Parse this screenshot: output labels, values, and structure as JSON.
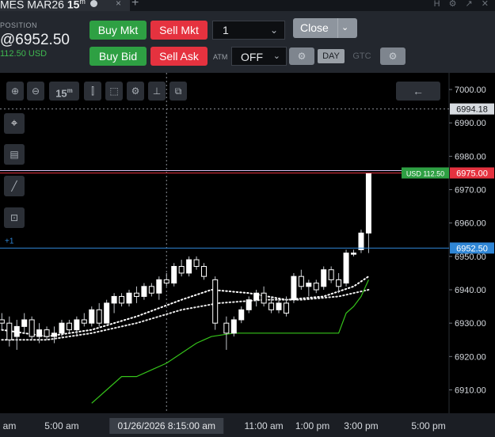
{
  "tab": {
    "title_a": "MES MAR26 ",
    "title_b": "15",
    "title_sup": "m",
    "close": "×",
    "plus": "+",
    "icons": "H ⚙ ↗ ✕"
  },
  "position": {
    "label": "POSITION",
    "price": "@6952.50",
    "usd": "112.50 USD"
  },
  "buttons": {
    "buy_mkt": "Buy Mkt",
    "sell_mkt": "Sell Mkt",
    "buy_bid": "Buy Bid",
    "sell_ask": "Sell Ask",
    "close": "Close",
    "quantity": "1",
    "atm_label": "ATM",
    "atm_value": "OFF",
    "day": "DAY",
    "gtc": "GTC"
  },
  "toolbar": {
    "interval": "15",
    "interval_sup": "m"
  },
  "colors": {
    "green": "#2ea043",
    "red": "#e5323f",
    "blue": "#2f86d6",
    "chart_bg": "#000000"
  },
  "chart_data": {
    "type": "candlestick",
    "title": "",
    "ylim": [
      6903,
      7005
    ],
    "y_ticks": [
      7000,
      6990,
      6980,
      6970,
      6960,
      6950,
      6940,
      6930,
      6920,
      6910
    ],
    "y_tick_labels": [
      "7000.00",
      "6990.00",
      "6980.00",
      "6970.00",
      "6960.00",
      "6950.00",
      "6940.00",
      "6930.00",
      "6920.00",
      "6910.00"
    ],
    "x_labels": [
      {
        "label": "am",
        "bar": 0
      },
      {
        "label": "5:00 am",
        "bar": 16
      },
      {
        "label": "11:00 am",
        "bar": 70
      },
      {
        "label": "1:00 pm",
        "bar": 83
      },
      {
        "label": "3:00 pm",
        "bar": 96
      },
      {
        "label": "5:00 pm",
        "bar": 114
      }
    ],
    "x_bar_count": 120,
    "crosshair_label": "01/26/2026 8:15:00 am",
    "crosshair_bar": 44,
    "crosshair_price": "6994.18",
    "crosshair_value": 6994.18,
    "price_lines": [
      {
        "value": 6975.0,
        "label": "6975.00",
        "color": "#e5323f",
        "tag": "USD 112.50"
      },
      {
        "value": 6952.5,
        "label": "6952.50",
        "color": "#2f86d6",
        "tag": "+1"
      }
    ],
    "candles": [
      {
        "bar": 0,
        "o": 6931,
        "h": 6933,
        "l": 6928,
        "c": 6930
      },
      {
        "bar": 2,
        "o": 6930,
        "h": 6932,
        "l": 6923,
        "c": 6925
      },
      {
        "bar": 4,
        "o": 6926,
        "h": 6931,
        "l": 6922,
        "c": 6929
      },
      {
        "bar": 6,
        "o": 6929,
        "h": 6933,
        "l": 6927,
        "c": 6931
      },
      {
        "bar": 8,
        "o": 6931,
        "h": 6932,
        "l": 6925,
        "c": 6926
      },
      {
        "bar": 10,
        "o": 6926,
        "h": 6930,
        "l": 6924,
        "c": 6928
      },
      {
        "bar": 12,
        "o": 6928,
        "h": 6929,
        "l": 6925,
        "c": 6926
      },
      {
        "bar": 14,
        "o": 6926,
        "h": 6929,
        "l": 6924,
        "c": 6927
      },
      {
        "bar": 16,
        "o": 6927,
        "h": 6931,
        "l": 6926,
        "c": 6930
      },
      {
        "bar": 18,
        "o": 6930,
        "h": 6931,
        "l": 6927,
        "c": 6928
      },
      {
        "bar": 20,
        "o": 6928,
        "h": 6932,
        "l": 6926,
        "c": 6931
      },
      {
        "bar": 22,
        "o": 6931,
        "h": 6933,
        "l": 6929,
        "c": 6930
      },
      {
        "bar": 24,
        "o": 6930,
        "h": 6935,
        "l": 6929,
        "c": 6934
      },
      {
        "bar": 26,
        "o": 6934,
        "h": 6936,
        "l": 6929,
        "c": 6930
      },
      {
        "bar": 28,
        "o": 6930,
        "h": 6937,
        "l": 6930,
        "c": 6936
      },
      {
        "bar": 30,
        "o": 6936,
        "h": 6939,
        "l": 6933,
        "c": 6938
      },
      {
        "bar": 32,
        "o": 6938,
        "h": 6939,
        "l": 6935,
        "c": 6936
      },
      {
        "bar": 34,
        "o": 6936,
        "h": 6940,
        "l": 6935,
        "c": 6939
      },
      {
        "bar": 36,
        "o": 6939,
        "h": 6941,
        "l": 6936,
        "c": 6938
      },
      {
        "bar": 38,
        "o": 6938,
        "h": 6942,
        "l": 6937,
        "c": 6941
      },
      {
        "bar": 40,
        "o": 6941,
        "h": 6942,
        "l": 6938,
        "c": 6939
      },
      {
        "bar": 42,
        "o": 6939,
        "h": 6944,
        "l": 6937,
        "c": 6943
      },
      {
        "bar": 44,
        "o": 6943,
        "h": 6945,
        "l": 6941,
        "c": 6942
      },
      {
        "bar": 46,
        "o": 6942,
        "h": 6948,
        "l": 6941,
        "c": 6947
      },
      {
        "bar": 48,
        "o": 6947,
        "h": 6949,
        "l": 6944,
        "c": 6945
      },
      {
        "bar": 50,
        "o": 6945,
        "h": 6950,
        "l": 6944,
        "c": 6949
      },
      {
        "bar": 52,
        "o": 6949,
        "h": 6950,
        "l": 6946,
        "c": 6947
      },
      {
        "bar": 54,
        "o": 6947,
        "h": 6948,
        "l": 6943,
        "c": 6944
      },
      {
        "bar": 57,
        "o": 6943,
        "h": 6944,
        "l": 6928,
        "c": 6930
      },
      {
        "bar": 60,
        "o": 6930,
        "h": 6932,
        "l": 6922,
        "c": 6927
      },
      {
        "bar": 62,
        "o": 6927,
        "h": 6932,
        "l": 6926,
        "c": 6931
      },
      {
        "bar": 64,
        "o": 6931,
        "h": 6935,
        "l": 6930,
        "c": 6934
      },
      {
        "bar": 66,
        "o": 6934,
        "h": 6938,
        "l": 6933,
        "c": 6937
      },
      {
        "bar": 68,
        "o": 6937,
        "h": 6940,
        "l": 6935,
        "c": 6939
      },
      {
        "bar": 70,
        "o": 6939,
        "h": 6941,
        "l": 6935,
        "c": 6936
      },
      {
        "bar": 72,
        "o": 6936,
        "h": 6938,
        "l": 6933,
        "c": 6934
      },
      {
        "bar": 74,
        "o": 6934,
        "h": 6937,
        "l": 6933,
        "c": 6936
      },
      {
        "bar": 76,
        "o": 6936,
        "h": 6938,
        "l": 6932,
        "c": 6933
      },
      {
        "bar": 78,
        "o": 6937,
        "h": 6945,
        "l": 6936,
        "c": 6944
      },
      {
        "bar": 80,
        "o": 6944,
        "h": 6946,
        "l": 6940,
        "c": 6941
      },
      {
        "bar": 82,
        "o": 6941,
        "h": 6943,
        "l": 6938,
        "c": 6942
      },
      {
        "bar": 84,
        "o": 6942,
        "h": 6943,
        "l": 6939,
        "c": 6940
      },
      {
        "bar": 86,
        "o": 6941,
        "h": 6947,
        "l": 6940,
        "c": 6946
      },
      {
        "bar": 88,
        "o": 6946,
        "h": 6947,
        "l": 6942,
        "c": 6943
      },
      {
        "bar": 90,
        "o": 6943,
        "h": 6945,
        "l": 6939,
        "c": 6941
      },
      {
        "bar": 92,
        "o": 6942,
        "h": 6952,
        "l": 6941,
        "c": 6951
      },
      {
        "bar": 94,
        "o": 6951,
        "h": 6952,
        "l": 6950,
        "c": 6951
      },
      {
        "bar": 96,
        "o": 6952,
        "h": 6958,
        "l": 6951,
        "c": 6957
      },
      {
        "bar": 98,
        "o": 6957,
        "h": 6975,
        "l": 6951,
        "c": 6975
      }
    ],
    "series": [
      {
        "color": "#ffffff",
        "style": "dotted",
        "points": [
          [
            0,
            6928
          ],
          [
            12,
            6926
          ],
          [
            24,
            6928
          ],
          [
            36,
            6932
          ],
          [
            48,
            6937
          ],
          [
            56,
            6940
          ],
          [
            66,
            6939
          ],
          [
            76,
            6937
          ],
          [
            86,
            6938
          ],
          [
            94,
            6941
          ],
          [
            98,
            6944
          ]
        ]
      },
      {
        "color": "#e8e8e8",
        "style": "dotted",
        "points": [
          [
            0,
            6925
          ],
          [
            12,
            6925
          ],
          [
            24,
            6927
          ],
          [
            36,
            6930
          ],
          [
            48,
            6934
          ],
          [
            58,
            6936
          ],
          [
            70,
            6937
          ],
          [
            80,
            6937
          ],
          [
            90,
            6938
          ],
          [
            98,
            6940
          ]
        ]
      },
      {
        "color": "#35c31a",
        "style": "step",
        "points": [
          [
            24,
            6906
          ],
          [
            28,
            6910
          ],
          [
            32,
            6914
          ],
          [
            36,
            6914
          ],
          [
            40,
            6916
          ],
          [
            44,
            6918
          ],
          [
            48,
            6921
          ],
          [
            52,
            6924
          ],
          [
            56,
            6926
          ],
          [
            62,
            6927
          ],
          [
            72,
            6927
          ],
          [
            82,
            6927
          ],
          [
            90,
            6927
          ],
          [
            92,
            6933
          ],
          [
            94,
            6935
          ],
          [
            96,
            6938
          ],
          [
            98,
            6943
          ]
        ]
      }
    ]
  }
}
